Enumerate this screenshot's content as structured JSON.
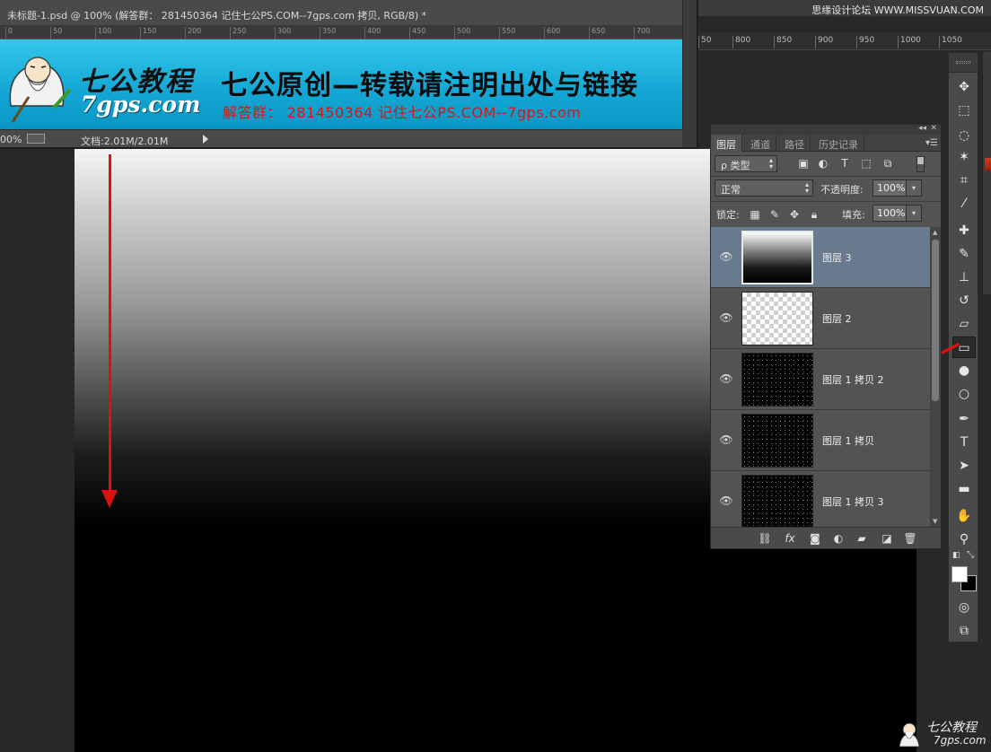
{
  "document": {
    "title": "未标题-1.psd @ 100% (解答群： 281450364    记住七公PS.COM--7gps.com 拷贝, RGB/8) *",
    "ruler_ticks": [
      "0",
      "50",
      "100",
      "150",
      "200",
      "250",
      "300",
      "350",
      "400",
      "450",
      "500",
      "550",
      "600",
      "650",
      "700"
    ],
    "status_zoom": "00%",
    "status_doc": "文档:2.01M/2.01M"
  },
  "banner": {
    "logo_cn": "七公教程",
    "logo_en": "7gps.com",
    "headline": "七公原创—转载请注明出处与链接",
    "subline": "解答群： 281450364    记住七公PS.COM--7gps.com"
  },
  "top_watermark": "思缘设计论坛 WWW.MISSVUAN.COM",
  "right_ruler_ticks": [
    "50",
    "800",
    "850",
    "900",
    "950",
    "1000",
    "1050"
  ],
  "layers_panel": {
    "tabs": [
      "图层",
      "通道",
      "路径",
      "历史记录"
    ],
    "active_tab": 0,
    "filter_kind": "ρ 类型",
    "blend_mode": "正常",
    "opacity_label": "不透明度:",
    "opacity_value": "100%",
    "lock_label": "锁定:",
    "fill_label": "填充:",
    "fill_value": "100%",
    "layers": [
      {
        "name": "图层 3",
        "thumb": "gradient",
        "selected": true
      },
      {
        "name": "图层 2",
        "thumb": "transparent",
        "selected": false
      },
      {
        "name": "图层 1 拷贝 2",
        "thumb": "noise",
        "selected": false
      },
      {
        "name": "图层 1 拷贝",
        "thumb": "noise",
        "selected": false
      },
      {
        "name": "图层 1 拷贝 3",
        "thumb": "noise",
        "selected": false
      }
    ],
    "footer_icons": [
      "link-icon",
      "fx-icon",
      "mask-icon",
      "adjustment-icon",
      "folder-icon",
      "new-layer-icon",
      "trash-icon"
    ],
    "footer_fx": "fx"
  },
  "tools": [
    {
      "name": "move-tool",
      "glyph": "✥"
    },
    {
      "name": "marquee-tool",
      "glyph": "⬚"
    },
    {
      "name": "lasso-tool",
      "glyph": "◌"
    },
    {
      "name": "magic-wand-tool",
      "glyph": "✶"
    },
    {
      "name": "crop-tool",
      "glyph": "⌗"
    },
    {
      "name": "eyedropper-tool",
      "glyph": "⁄"
    },
    {
      "name": "healing-brush-tool",
      "glyph": "✚"
    },
    {
      "name": "brush-tool",
      "glyph": "✎"
    },
    {
      "name": "stamp-tool",
      "glyph": "⊥"
    },
    {
      "name": "history-brush-tool",
      "glyph": "↺"
    },
    {
      "name": "eraser-tool",
      "glyph": "▱"
    },
    {
      "name": "gradient-tool",
      "glyph": "▭"
    },
    {
      "name": "blur-tool",
      "glyph": "●"
    },
    {
      "name": "dodge-tool",
      "glyph": "○"
    },
    {
      "name": "pen-tool",
      "glyph": "✒"
    },
    {
      "name": "type-tool",
      "glyph": "T"
    },
    {
      "name": "path-selection-tool",
      "glyph": "➤"
    },
    {
      "name": "shape-tool",
      "glyph": "▬"
    },
    {
      "name": "hand-tool",
      "glyph": "✋"
    },
    {
      "name": "zoom-tool",
      "glyph": "⚲"
    }
  ],
  "active_tool": "gradient-tool",
  "colors": {
    "foreground": "#ffffff",
    "background": "#000000",
    "annotation_red": "#e01010"
  },
  "bottom_watermark": {
    "cn": "七公教程",
    "en": "7gps.com"
  }
}
